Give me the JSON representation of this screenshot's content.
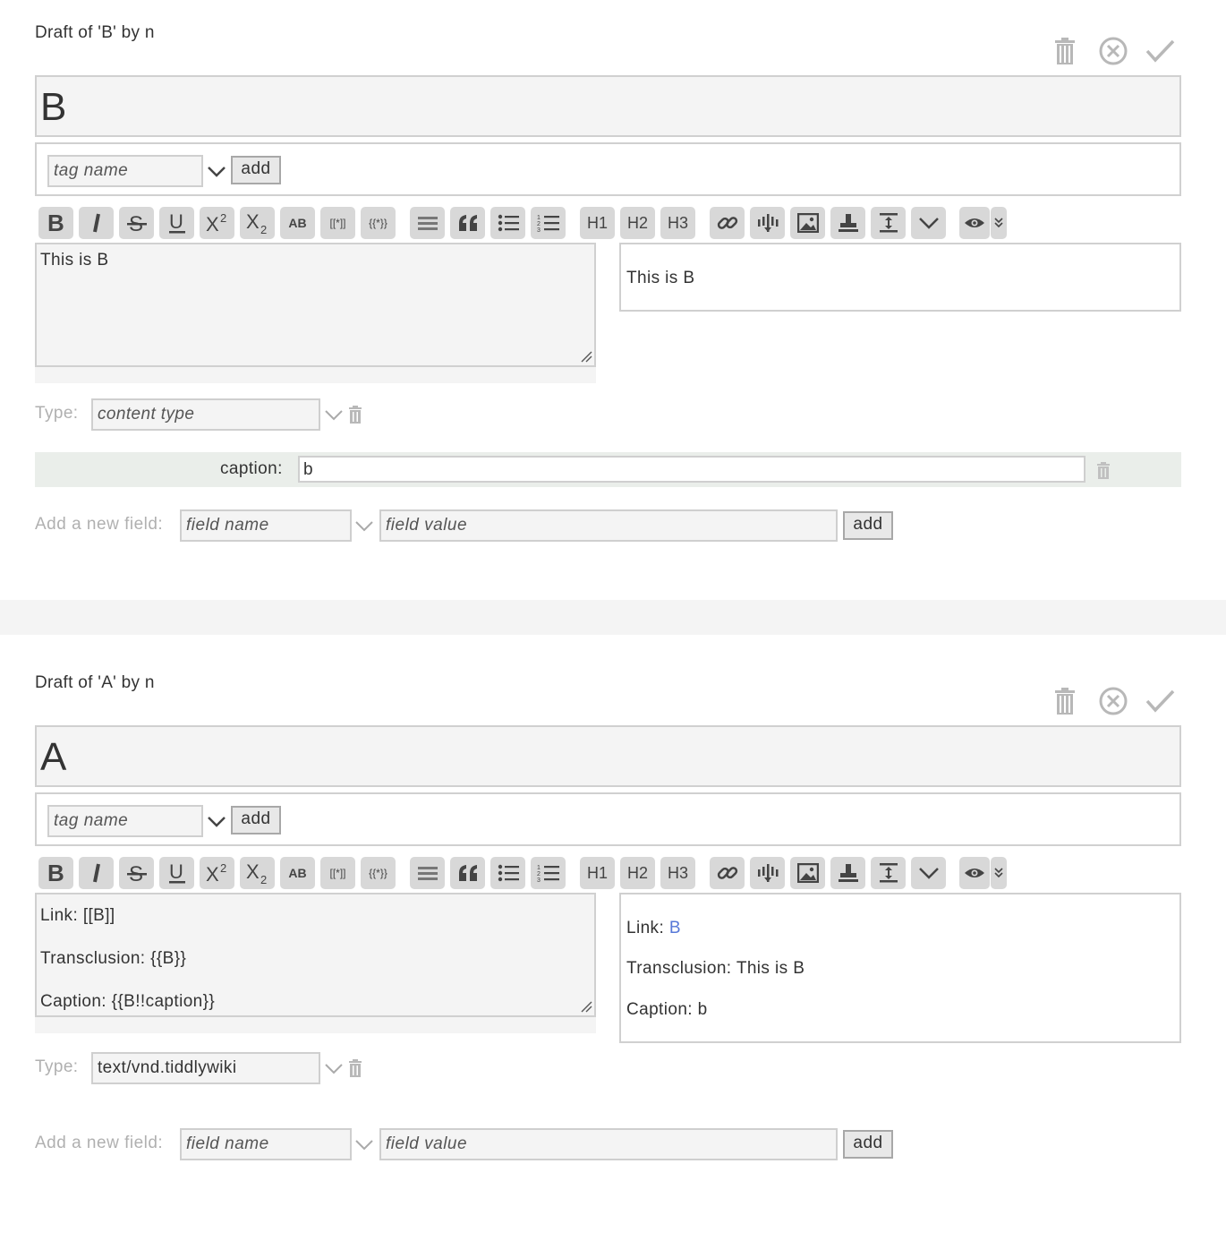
{
  "tiddlers": [
    {
      "subtitle": "Draft of 'B' by n",
      "title_value": "B",
      "tag_placeholder": "tag name",
      "tag_add_label": "add",
      "body_text": "This is B",
      "preview": {
        "line1": "This is B"
      },
      "type_label": "Type:",
      "type_value": "content type",
      "fields": [
        {
          "name": "caption:",
          "value": "b"
        }
      ],
      "new_field_label": "Add a new field:",
      "new_field_name_placeholder": "field name",
      "new_field_value_placeholder": "field value",
      "new_field_add_label": "add"
    },
    {
      "subtitle": "Draft of 'A' by n",
      "title_value": "A",
      "tag_placeholder": "tag name",
      "tag_add_label": "add",
      "body_text": "Link: [[B]]\nTransclusion: {{B}}\nCaption: {{B!!caption}}",
      "preview": {
        "link_prefix": "Link: ",
        "link_text": "B",
        "transclusion": "Transclusion: This is B",
        "caption": "Caption: b"
      },
      "type_label": "Type:",
      "type_value": "text/vnd.tiddlywiki",
      "new_field_label": "Add a new field:",
      "new_field_name_placeholder": "field name",
      "new_field_value_placeholder": "field value",
      "new_field_add_label": "add"
    }
  ],
  "toolbar": {
    "buttons": [
      "bold",
      "italic",
      "strikethrough",
      "underline",
      "superscript",
      "subscript",
      "smallcaps",
      "wikilink",
      "transclude",
      "monospaced-block",
      "quote",
      "bulleted-list",
      "numbered-list",
      "heading-1",
      "heading-2",
      "heading-3",
      "link",
      "excise",
      "picture",
      "stamp",
      "size",
      "more",
      "preview",
      "preview-type"
    ],
    "labels": {
      "smallcaps": "AB",
      "wikilink": "[[*]]",
      "transclude": "{{*}}",
      "h1": "H1",
      "h2": "H2",
      "h3": "H3"
    }
  },
  "colors": {
    "link": "#5778d8",
    "field_row_bg": "#eaeeea",
    "button_bg": "#d8d8d8",
    "input_bg": "#f4f4f4"
  }
}
